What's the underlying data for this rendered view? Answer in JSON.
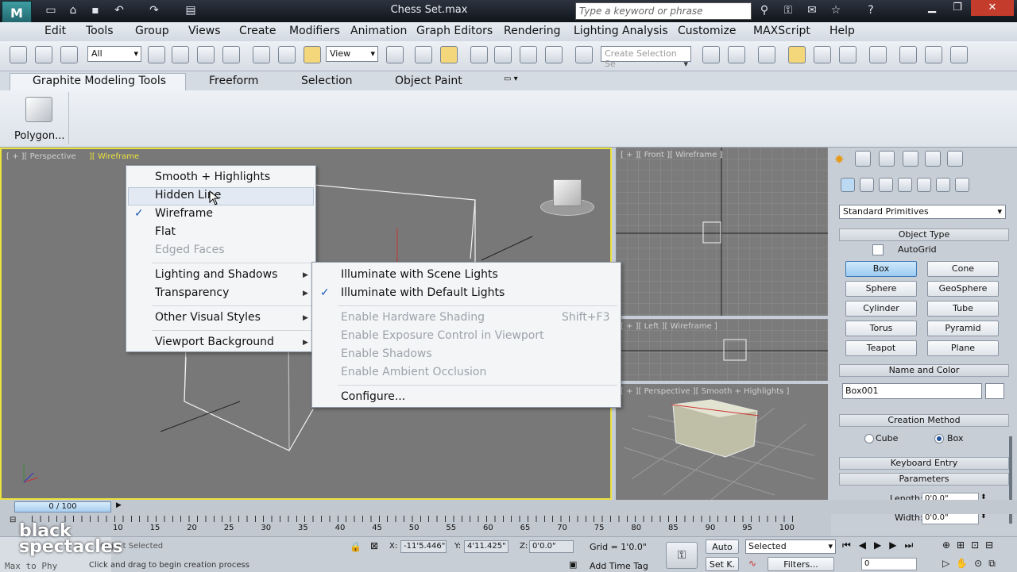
{
  "window": {
    "title": "Chess Set.max",
    "search_placeholder": "Type a keyword or phrase"
  },
  "menubar": [
    "Edit",
    "Tools",
    "Group",
    "Views",
    "Create",
    "Modifiers",
    "Animation",
    "Graph Editors",
    "Rendering",
    "Lighting Analysis",
    "Customize",
    "MAXScript",
    "Help"
  ],
  "toolbar": {
    "filter_value": "All",
    "ref_coord_value": "View",
    "named_sel_placeholder": "Create Selection Se"
  },
  "ribbon": {
    "tabs": [
      "Graphite Modeling Tools",
      "Freeform",
      "Selection",
      "Object Paint"
    ],
    "panel_label": "Polygon..."
  },
  "viewports": {
    "main": {
      "label_a": "[ + ][ Perspective",
      "label_b": "][ Wireframe"
    },
    "front": {
      "label": "[ + ][ Front ][ Wireframe ]"
    },
    "left": {
      "label": "[ + ][ Left ][ Wireframe ]"
    },
    "persp": {
      "label": "[ + ][ Perspective ][ Smooth + Highlights ]"
    }
  },
  "context_menu": {
    "items": [
      "Smooth + Highlights",
      "Hidden Line",
      "Wireframe",
      "Flat",
      "Edged Faces",
      "Lighting and Shadows",
      "Transparency",
      "Other Visual Styles",
      "Viewport Background"
    ]
  },
  "submenu": {
    "items": [
      "Illuminate with Scene Lights",
      "Illuminate with Default Lights",
      "Enable Hardware Shading",
      "Enable Exposure Control in Viewport",
      "Enable Shadows",
      "Enable Ambient Occlusion",
      "Configure..."
    ],
    "shortcut": "Shift+F3"
  },
  "command_panel": {
    "dropdown": "Standard Primitives",
    "object_type": "Object Type",
    "autogrid": "AutoGrid",
    "buttons": [
      "Box",
      "Cone",
      "Sphere",
      "GeoSphere",
      "Cylinder",
      "Tube",
      "Torus",
      "Pyramid",
      "Teapot",
      "Plane"
    ],
    "name_and_color": "Name and Color",
    "object_name": "Box001",
    "creation_method": "Creation Method",
    "cube": "Cube",
    "box": "Box",
    "keyboard_entry": "Keyboard Entry",
    "parameters": "Parameters",
    "length_label": "Length:",
    "length_value": "0'0.0\"",
    "width_label": "Width:",
    "width_value": "0'0.0\""
  },
  "timeline": {
    "frame": "0 / 100",
    "ticks": [
      "10",
      "15",
      "20",
      "25",
      "30",
      "35",
      "40",
      "45",
      "50",
      "55",
      "60",
      "65",
      "70",
      "75",
      "80",
      "85",
      "90",
      "95",
      "100"
    ]
  },
  "status": {
    "selection": "Object Selected",
    "prompt": "Click and drag to begin creation process",
    "maxscript": "Max to Phy",
    "x_label": "X:",
    "x_value": "-11'5.446\"",
    "y_label": "Y:",
    "y_value": "4'11.425\"",
    "z_label": "Z:",
    "z_value": "0'0.0\"",
    "grid": "Grid = 1'0.0\"",
    "add_time_tag": "Add Time Tag",
    "auto": "Auto",
    "set_key": "Set K.",
    "key_filter": "Selected",
    "filters": "Filters...",
    "frame_field": "0"
  },
  "watermark": {
    "line1": "black",
    "line2": "spectacles"
  }
}
